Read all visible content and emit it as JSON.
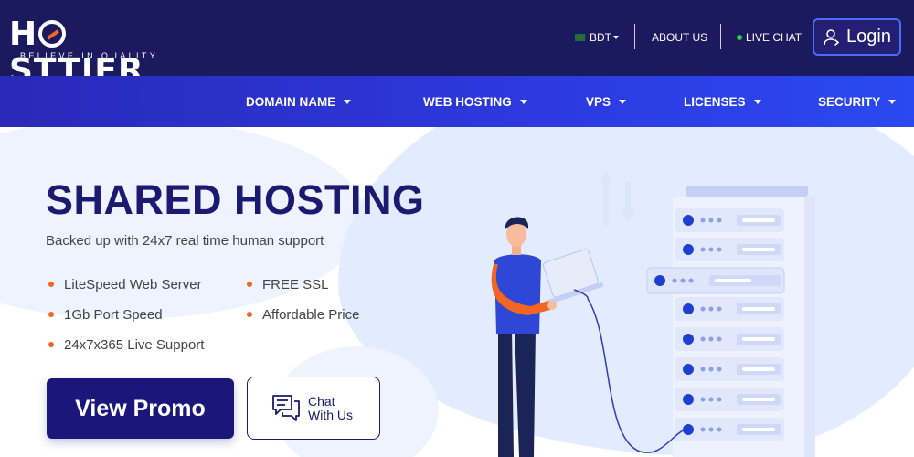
{
  "brand": {
    "logo_text": "HOSTTIER",
    "tagline": "BELIEVE IN QUALITY"
  },
  "topbar": {
    "currency": "BDT",
    "about_label": "ABOUT US",
    "live_chat_label": "LIVE CHAT",
    "login_label": "Login"
  },
  "nav": {
    "items": [
      {
        "label": "DOMAIN NAME"
      },
      {
        "label": "WEB HOSTING"
      },
      {
        "label": "VPS"
      },
      {
        "label": "LICENSES"
      },
      {
        "label": "SECURITY"
      }
    ]
  },
  "hero": {
    "title": "SHARED HOSTING",
    "subtitle": "Backed up with 24x7 real time human support",
    "features": [
      "LiteSpeed Web Server",
      "FREE SSL",
      "1Gb Port Speed",
      "Affordable Price",
      "24x7x365 Live Support"
    ],
    "promo_button": "View Promo",
    "chat_button": "Chat With Us"
  },
  "colors": {
    "topbar_bg": "#1b1a5e",
    "nav_bg": "#2c3ae0",
    "accent_orange": "#f26522",
    "title_navy": "#1b1a70"
  },
  "icons": [
    "flag-bd-icon",
    "live-dot-icon",
    "user-login-icon",
    "chat-bubbles-icon",
    "caret-down-icon"
  ]
}
